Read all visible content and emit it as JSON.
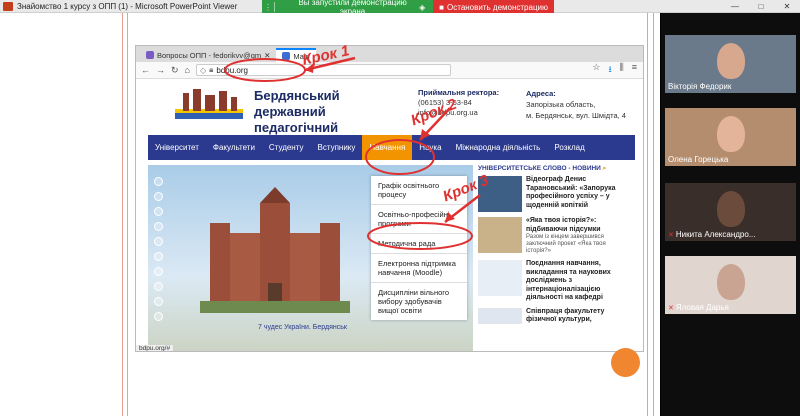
{
  "window": {
    "title": "Знайомство 1 курсу з ОПП (1) - Microsoft PowerPoint Viewer",
    "min": "—",
    "max": "□",
    "close": "✕"
  },
  "share_bar": {
    "message": "Вы запустили демонстрацию экрана",
    "stop": "Остановить демонстрацию"
  },
  "browser": {
    "tabs": [
      {
        "label": "Вопросы ОПП - fedorikvv@gm"
      },
      {
        "label": "Main"
      }
    ],
    "url": "bdpu.org",
    "status_url": "bdpu.org/#"
  },
  "site": {
    "name_line1": "Бердянський державний",
    "name_line2": "педагогічний університет",
    "reception_title": "Приймальня ректора:",
    "reception_phone": "(06153) 3-63-84",
    "reception_email": "info@bdpu.org.ua",
    "address_title": "Адреса:",
    "address_line1": "Запорізька область,",
    "address_line2": "м. Бердянськ, вул. Шмідта, 4",
    "nav": [
      "Університет",
      "Факультети",
      "Студенту",
      "Вступнику",
      "Навчання",
      "Наука",
      "Міжнародна діяльність",
      "Розклад"
    ],
    "dropdown": [
      "Графік освітнього процесу",
      "Освітньо-професійні програми",
      "Методична рада",
      "Електронна підтримка навчання (Moodle)",
      "Дисципліни вільного вибору здобувачів вищої освіти"
    ],
    "hero_caption": "7 чудес України. Бердянськ",
    "news_header": "УНІВЕРСИТЕТСЬКЕ СЛОВО - НОВИНИ",
    "news": [
      {
        "title": "Відеограф Денис Тарановський: «Запорука професійного успіху – у щоденній копіткій"
      },
      {
        "title": "«Яка твоя історія?»: підбиваючи підсумки",
        "sub": "Разом із кінцем завершився заключний проект «Яка твоя історія?»"
      },
      {
        "title": "Поєднання навчання, викладання та наукових досліджень з інтернаціоналізацією діяльності на кафедрі"
      },
      {
        "title": "Співпраця факультету фізичної культури,"
      }
    ]
  },
  "annotations": [
    "Крок 1",
    "Крок 2",
    "Крок 3"
  ],
  "participants": [
    {
      "name": "Вікторія Федорик"
    },
    {
      "name": "Олена Горецька"
    },
    {
      "name": "Никита Александро..."
    },
    {
      "name": "Яловая Дарья"
    }
  ]
}
